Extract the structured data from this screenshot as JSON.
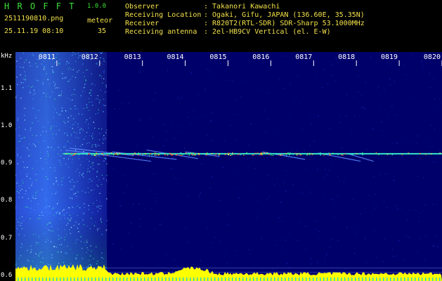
{
  "header": {
    "app_name": "H R O F F T",
    "version": "1.0.0",
    "filename": "2511190810.png",
    "meteor_label": "meteor",
    "datetime": "25.11.19 08:10",
    "meteor_count": "35",
    "fields": [
      {
        "key": "Observer",
        "value": ": Takanori Kawachi"
      },
      {
        "key": "Receiving Location",
        "value": ": Ogaki, Gifu, JAPAN (136.60E, 35.35N)"
      },
      {
        "key": "Receiver",
        "value": ": R820T2(RTL-SDR) SDR-Sharp 53.1000MHz"
      },
      {
        "key": "Receiving antenna",
        "value": ": 2el-HB9CV Vertical (el. E-W)"
      }
    ]
  },
  "colors": {
    "background": "#00006b",
    "carrier": "#33e6c8",
    "profile": "#ffff00",
    "header_green": "#3ee03a",
    "header_yellow": "#f2e14a"
  },
  "chart_data": {
    "type": "heatmap",
    "ylabel": "kHz",
    "x_ticks": [
      "0811",
      "0812",
      "0813",
      "0814",
      "0815",
      "0816",
      "0817",
      "0818",
      "0819",
      "0820"
    ],
    "y_ticks": [
      "1.1",
      "1.0",
      "0.9",
      "0.8",
      "0.7",
      "0.6"
    ],
    "y_tick_values": [
      1.1,
      1.0,
      0.9,
      0.8,
      0.7,
      0.6
    ],
    "ylim": [
      0.585,
      1.197
    ],
    "xlim": [
      8.1,
      8.2
    ],
    "carrier_khz": 0.925,
    "noise_band_minutes": [
      8.1,
      8.1217
    ],
    "meteor_traces": [
      {
        "t0": 8.112,
        "f0": 0.935,
        "t1": 8.132,
        "f1": 0.905
      },
      {
        "t0": 8.113,
        "f0": 0.94,
        "t1": 8.128,
        "f1": 0.92
      },
      {
        "t0": 8.123,
        "f0": 0.93,
        "t1": 8.138,
        "f1": 0.91
      },
      {
        "t0": 8.131,
        "f0": 0.935,
        "t1": 8.143,
        "f1": 0.912
      },
      {
        "t0": 8.14,
        "f0": 0.93,
        "t1": 8.148,
        "f1": 0.918
      },
      {
        "t0": 8.158,
        "f0": 0.93,
        "t1": 8.168,
        "f1": 0.91
      },
      {
        "t0": 8.171,
        "f0": 0.927,
        "t1": 8.181,
        "f1": 0.905
      },
      {
        "t0": 8.178,
        "f0": 0.925,
        "t1": 8.184,
        "f1": 0.905
      }
    ]
  }
}
